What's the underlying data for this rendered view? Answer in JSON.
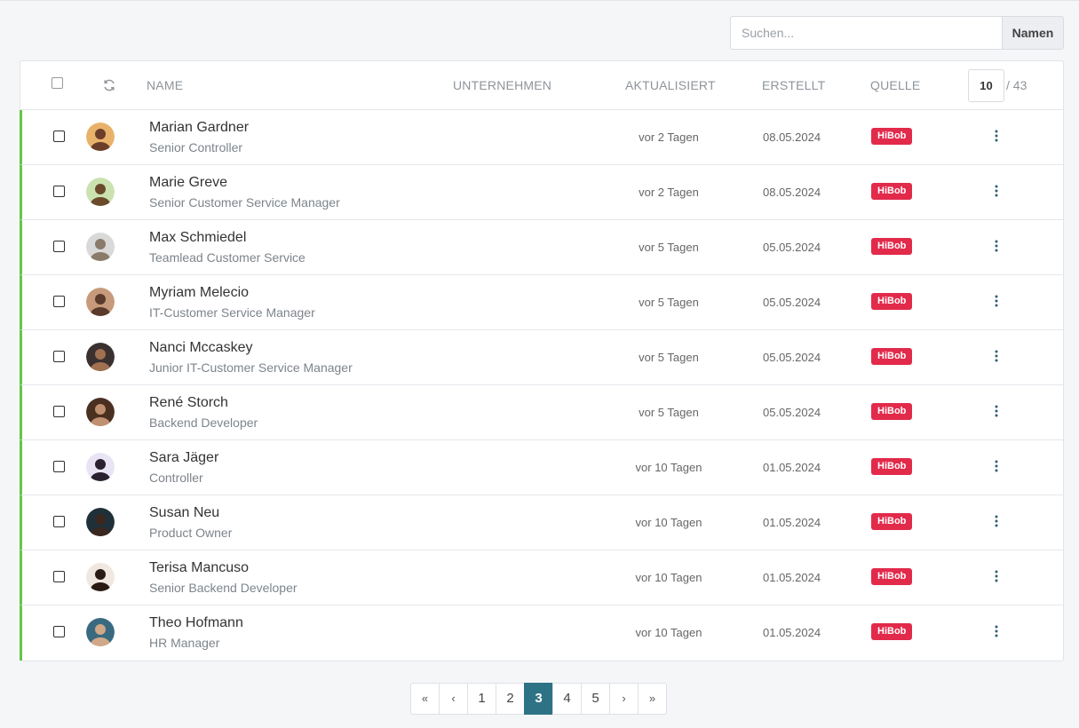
{
  "search": {
    "placeholder": "Suchen...",
    "button_label": "Namen"
  },
  "table": {
    "headers": {
      "name": "NAME",
      "company": "UNTERNEHMEN",
      "updated": "AKTUALISIERT",
      "created": "ERSTELLT",
      "source": "QUELLE"
    },
    "page_size": "10",
    "total": "/ 43",
    "rows": [
      {
        "name": "Marian Gardner",
        "role": "Senior Controller",
        "updated": "vor 2 Tagen",
        "created": "08.05.2024",
        "source": "HiBob"
      },
      {
        "name": "Marie Greve",
        "role": "Senior Customer Service Manager",
        "updated": "vor 2 Tagen",
        "created": "08.05.2024",
        "source": "HiBob"
      },
      {
        "name": "Max Schmiedel",
        "role": "Teamlead Customer Service",
        "updated": "vor 5 Tagen",
        "created": "05.05.2024",
        "source": "HiBob"
      },
      {
        "name": "Myriam Melecio",
        "role": "IT-Customer Service Manager",
        "updated": "vor 5 Tagen",
        "created": "05.05.2024",
        "source": "HiBob"
      },
      {
        "name": "Nanci Mccaskey",
        "role": "Junior IT-Customer Service Manager",
        "updated": "vor 5 Tagen",
        "created": "05.05.2024",
        "source": "HiBob"
      },
      {
        "name": "René Storch",
        "role": "Backend Developer",
        "updated": "vor 5 Tagen",
        "created": "05.05.2024",
        "source": "HiBob"
      },
      {
        "name": "Sara Jäger",
        "role": "Controller",
        "updated": "vor 10 Tagen",
        "created": "01.05.2024",
        "source": "HiBob"
      },
      {
        "name": "Susan Neu",
        "role": "Product Owner",
        "updated": "vor 10 Tagen",
        "created": "01.05.2024",
        "source": "HiBob"
      },
      {
        "name": "Terisa Mancuso",
        "role": "Senior Backend Developer",
        "updated": "vor 10 Tagen",
        "created": "01.05.2024",
        "source": "HiBob"
      },
      {
        "name": "Theo Hofmann",
        "role": "HR Manager",
        "updated": "vor 10 Tagen",
        "created": "01.05.2024",
        "source": "HiBob"
      }
    ]
  },
  "pagination": {
    "first": "«",
    "prev": "‹",
    "next": "›",
    "last": "»",
    "pages": [
      "1",
      "2",
      "3",
      "4",
      "5"
    ],
    "current": "3"
  },
  "colors": {
    "accent": "#2e7385",
    "row_marker": "#63c54a",
    "badge": "#e22a4b"
  },
  "icons": {
    "refresh": "refresh-icon",
    "more": "more-vertical-icon",
    "avatar": "avatar"
  }
}
